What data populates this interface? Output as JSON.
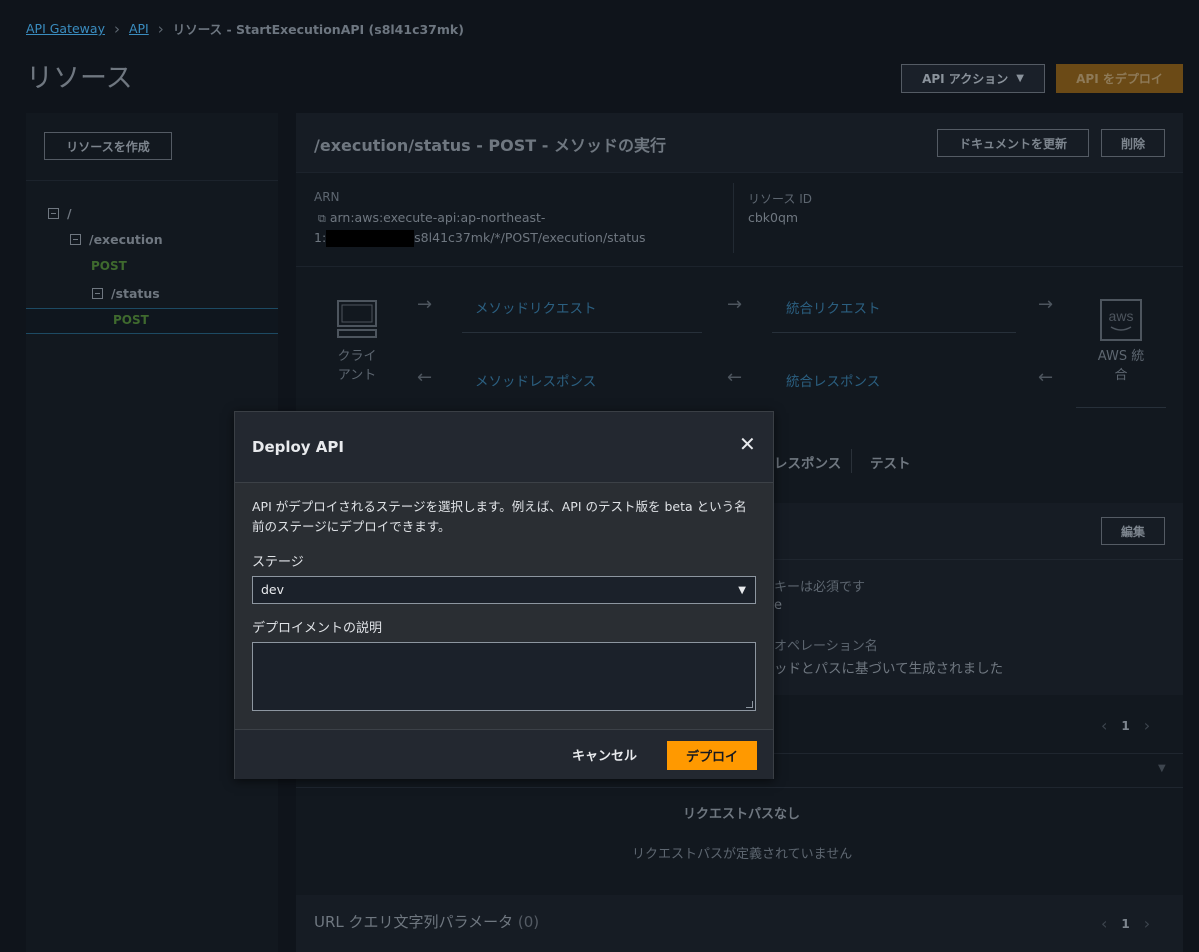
{
  "breadcrumb": {
    "items": [
      "API Gateway",
      "API"
    ],
    "current": "リソース - StartExecutionAPI (s8l41c37mk)"
  },
  "page_title": "リソース",
  "header_buttons": {
    "api_actions": "API アクション",
    "deploy_api": "API をデプロイ"
  },
  "sidebar": {
    "create_button": "リソースを作成",
    "tree": {
      "root": "/",
      "execution": "/execution",
      "execution_method": "POST",
      "status": "/status",
      "status_method": "POST"
    }
  },
  "method": {
    "title": "/execution/status - POST - メソッドの実行",
    "update_docs_button": "ドキュメントを更新",
    "delete_button": "削除",
    "arn_label": "ARN",
    "arn_line1": "arn:aws:execute-api:ap-northeast-",
    "arn_line2_prefix": "1:",
    "arn_line2_suffix": "s8l41c37mk/*/POST/execution/status",
    "resource_id_label": "リソース ID",
    "resource_id": "cbk0qm"
  },
  "flow": {
    "client_line1": "クライ",
    "client_line2": "アント",
    "method_request": "メソッドリクエスト",
    "integration_request": "統合リクエスト",
    "method_response": "メソッドレスポンス",
    "integration_response": "統合レスポンス",
    "aws_logo": "aws",
    "aws_line1": "AWS 統",
    "aws_line2": "合"
  },
  "tabs": {
    "response_tab": "レスポンス",
    "test_tab": "テスト"
  },
  "settings": {
    "edit_button": "編集",
    "partial_1": "キーは必須です",
    "partial_2": "e",
    "partial_3": "オペレーション名",
    "partial_4": "ッドとパスに基づいて生成されました"
  },
  "request_paths": {
    "page": "1",
    "empty_title": "リクエストパスなし",
    "empty_desc": "リクエストパスが定義されていません"
  },
  "query_params": {
    "title": "URL クエリ文字列パラメータ",
    "count": "(0)",
    "page": "1"
  },
  "modal": {
    "title": "Deploy API",
    "description": "API がデプロイされるステージを選択します。例えば、API のテスト版を beta という名前のステージにデプロイできます。",
    "stage_label": "ステージ",
    "stage_value": "dev",
    "desc_label": "デプロイメントの説明",
    "cancel": "キャンセル",
    "deploy": "デプロイ"
  }
}
